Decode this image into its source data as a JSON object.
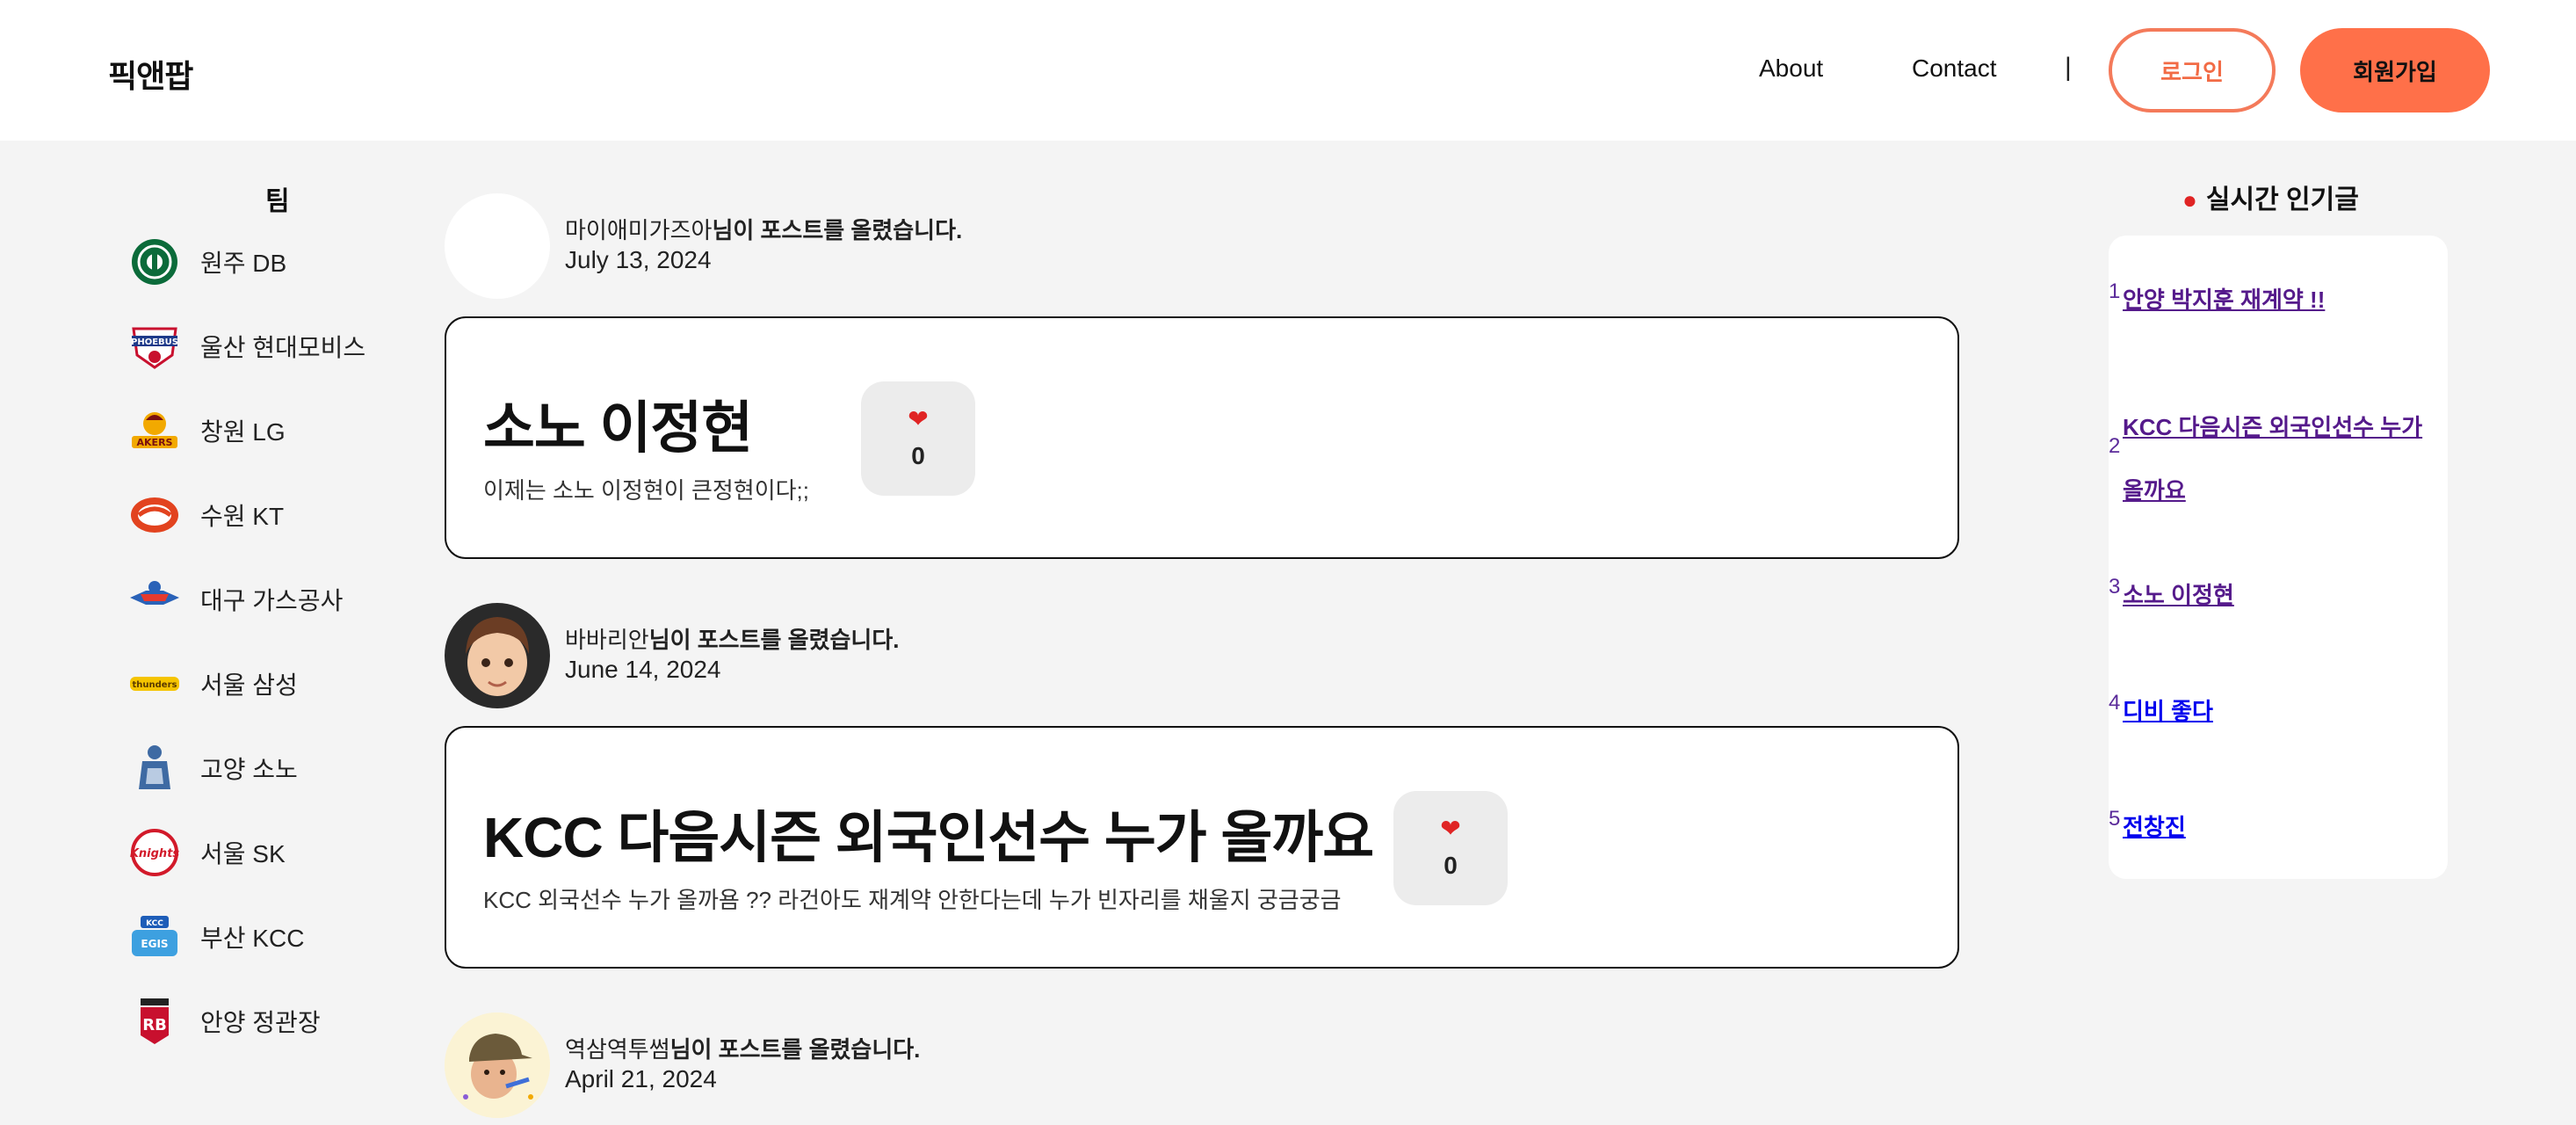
{
  "header": {
    "logo": "픽앤팝",
    "nav": {
      "about": "About",
      "contact": "Contact",
      "separator": "|"
    },
    "login_label": "로그인",
    "signup_label": "회원가입",
    "accent_color": "#ff7049"
  },
  "teams": {
    "title": "팀",
    "items": [
      {
        "name": "원주 DB",
        "icon": "db-promy-logo"
      },
      {
        "name": "울산 현대모비스",
        "icon": "phoebus-logo"
      },
      {
        "name": "창원 LG",
        "icon": "lg-sakers-logo"
      },
      {
        "name": "수원 KT",
        "icon": "kt-sonicboom-logo"
      },
      {
        "name": "대구 가스공사",
        "icon": "pegasus-logo"
      },
      {
        "name": "서울 삼성",
        "icon": "thunders-logo"
      },
      {
        "name": "고양 소노",
        "icon": "skygunners-logo"
      },
      {
        "name": "서울 SK",
        "icon": "knights-logo"
      },
      {
        "name": "부산 KCC",
        "icon": "egis-logo"
      },
      {
        "name": "안양 정관장",
        "icon": "red-boosters-logo"
      }
    ]
  },
  "feed": {
    "posts": [
      {
        "author": "마이애미가즈아",
        "action": "님이 포스트를 올렸습니다.",
        "date": "July 13, 2024",
        "title": "소노 이정현",
        "excerpt": "이제는 소노 이정현이 큰정현이다;;",
        "likes": "0"
      },
      {
        "author": "바바리안",
        "action": "님이 포스트를 올렸습니다.",
        "date": "June 14, 2024",
        "title": "KCC 다음시즌 외국인선수 누가 올까요",
        "excerpt": "KCC 외국선수 누가 올까욤 ?? 라건아도 재계약 안한다는데 누가 빈자리를 채울지 궁금궁금",
        "likes": "0"
      },
      {
        "author": "역삼역투썸",
        "action": "님이 포스트를 올렸습니다.",
        "date": "April 21, 2024"
      }
    ],
    "like_icon": "heart-icon"
  },
  "popular": {
    "title": "실시간 인기글",
    "icon": "balloon-icon",
    "items": [
      {
        "rank": "1",
        "title": "안양 박지훈 재계약 !!"
      },
      {
        "rank": "2",
        "title": "KCC 다음시즌 외국인선수 누가 올까요"
      },
      {
        "rank": "3",
        "title": "소노 이정현"
      },
      {
        "rank": "4",
        "title": "디비 좋다"
      },
      {
        "rank": "5",
        "title": "전창진"
      }
    ]
  }
}
